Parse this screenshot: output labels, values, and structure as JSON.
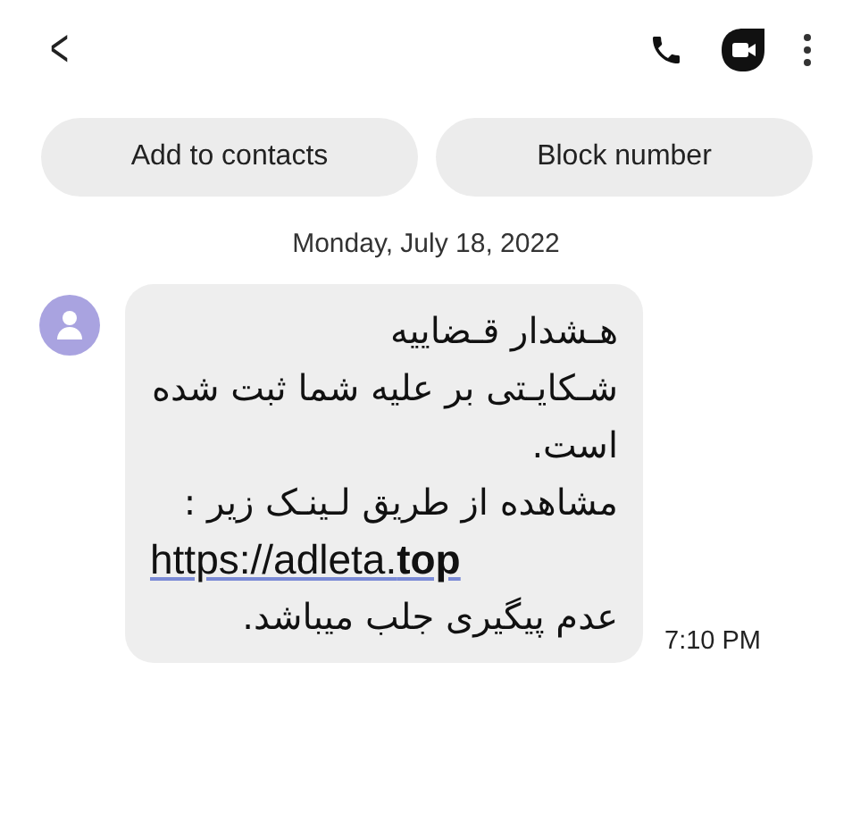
{
  "header": {
    "back": "<"
  },
  "add_contact_button": "Add to contacts",
  "block_button": "Block number",
  "date": "Monday, July 18, 2022",
  "message": {
    "lines": [
      {
        "kind": "text",
        "text": "هـشدار قـضاییه"
      },
      {
        "kind": "text",
        "text": "شـکایـتی بر علیه شما ثبت شده"
      },
      {
        "kind": "text",
        "text": "است."
      },
      {
        "kind": "text",
        "text": "مشاهده از طریق لـینـک زیر :"
      },
      {
        "kind": "link",
        "text": "https://adleta.**top**"
      },
      {
        "kind": "text",
        "text": "عدم پیگیری جلب میباشد."
      }
    ],
    "time": "7:10 PM"
  }
}
